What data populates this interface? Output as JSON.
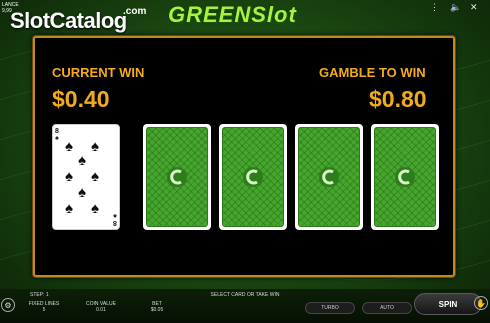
{
  "header": {
    "balance_label": "LANCE",
    "balance_value": "9,99",
    "watermark_text": "SlotCatalog",
    "watermark_suffix": ".com",
    "game_logo": "GREENSlot",
    "menu_icon": "menu-dots-icon",
    "sound_icon": "sound-icon",
    "close_icon": "close-icon"
  },
  "gamble": {
    "current_win_label": "CURRENT WIN",
    "current_win_value": "$0.40",
    "gamble_to_win_label": "GAMBLE TO WIN",
    "gamble_to_win_value": "$0.80",
    "dealer_card": {
      "rank": "8",
      "suit": "spades"
    },
    "choice_cards": 4
  },
  "footer": {
    "step": "STEP: 1",
    "instruction": "SELECT CARD OR TAKE WIN",
    "fixed_lines_label": "FIXED LINES",
    "fixed_lines_value": "5",
    "coin_value_label": "COIN VALUE",
    "coin_value_value": "0.01",
    "bet_label": "BET",
    "bet_value": "$0.05",
    "turbo_label": "TURBO",
    "auto_label": "AUTO",
    "spin_label": "SPIN",
    "settings_icon": "settings-icon",
    "take_win_icon": "take-win-icon"
  },
  "colors": {
    "accent": "#f3ab1d",
    "background": "#1c4a12",
    "card_back": "#47a52e"
  }
}
